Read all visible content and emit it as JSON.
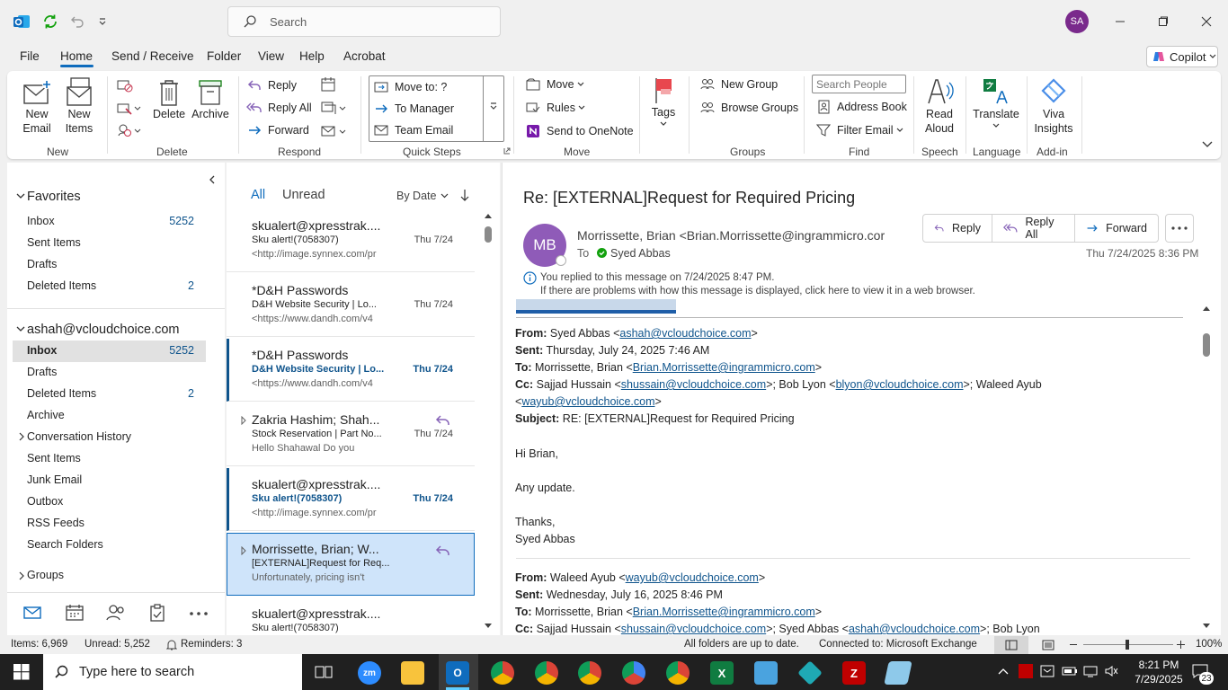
{
  "titlebar": {
    "search_placeholder": "Search",
    "avatar_initials": "SA"
  },
  "menu": {
    "tabs": [
      "File",
      "Home",
      "Send / Receive",
      "Folder",
      "View",
      "Help",
      "Acrobat"
    ],
    "copilot": "Copilot"
  },
  "ribbon": {
    "new_email": "New Email",
    "new_items": "New Items",
    "delete": "Delete",
    "archive": "Archive",
    "reply": "Reply",
    "reply_all": "Reply All",
    "forward": "Forward",
    "qs_move_to": "Move to: ?",
    "qs_to_manager": "To Manager",
    "qs_team_email": "Team Email",
    "move": "Move",
    "rules": "Rules",
    "send_onenote": "Send to OneNote",
    "tags": "Tags",
    "new_group": "New Group",
    "browse_groups": "Browse Groups",
    "search_people_placeholder": "Search People",
    "address_book": "Address Book",
    "filter_email": "Filter Email",
    "read_aloud": "Read Aloud",
    "translate": "Translate",
    "viva_insights": "Viva Insights",
    "groups": {
      "new": "New",
      "delete": "Delete",
      "respond": "Respond",
      "quick_steps": "Quick Steps",
      "move": "Move",
      "groups": "Groups",
      "find": "Find",
      "speech": "Speech",
      "language": "Language",
      "addin": "Add-in"
    }
  },
  "nav": {
    "favorites_label": "Favorites",
    "favorites": [
      {
        "label": "Inbox",
        "count": "5252"
      },
      {
        "label": "Sent Items",
        "count": ""
      },
      {
        "label": "Drafts",
        "count": ""
      },
      {
        "label": "Deleted Items",
        "count": "2"
      }
    ],
    "account": "ashah@vcloudchoice.com",
    "folders": [
      {
        "label": "Inbox",
        "count": "5252"
      },
      {
        "label": "Drafts",
        "count": ""
      },
      {
        "label": "Deleted Items",
        "count": "2"
      },
      {
        "label": "Archive",
        "count": ""
      },
      {
        "label": "Conversation History",
        "count": ""
      },
      {
        "label": "Sent Items",
        "count": ""
      },
      {
        "label": "Junk Email",
        "count": ""
      },
      {
        "label": "Outbox",
        "count": ""
      },
      {
        "label": "RSS Feeds",
        "count": ""
      },
      {
        "label": "Search Folders",
        "count": ""
      }
    ],
    "groups_label": "Groups"
  },
  "list": {
    "tab_all": "All",
    "tab_unread": "Unread",
    "sort": "By Date",
    "messages": [
      {
        "from": "skualert@xpresstrak....",
        "subject": "Sku alert!(7058307)",
        "date": "Thu 7/24",
        "preview": "<http://image.synnex.com/pr"
      },
      {
        "from": "*D&H Passwords",
        "subject": "D&H Website Security | Lo...",
        "date": "Thu 7/24",
        "preview": "<https://www.dandh.com/v4"
      },
      {
        "from": "*D&H Passwords",
        "subject": "D&H Website Security | Lo...",
        "date": "Thu 7/24",
        "preview": "<https://www.dandh.com/v4"
      },
      {
        "from": "Zakria Hashim;  Shah...",
        "subject": "Stock Reservation | Part No...",
        "date": "Thu 7/24",
        "preview": "Hello Shahawal  Do you"
      },
      {
        "from": "skualert@xpresstrak....",
        "subject": "Sku alert!(7058307)",
        "date": "Thu 7/24",
        "preview": "<http://image.synnex.com/pr"
      },
      {
        "from": "Morrissette, Brian;  W...",
        "subject": "[EXTERNAL]Request for Req...",
        "date": "",
        "preview": "Unfortunately, pricing isn't"
      },
      {
        "from": "skualert@xpresstrak....",
        "subject": "Sku alert!(7058307)",
        "date": "",
        "preview": ""
      }
    ]
  },
  "reading": {
    "subject": "Re: [EXTERNAL]Request for Required Pricing",
    "sender_initials": "MB",
    "sender": "Morrissette, Brian <Brian.Morrissette@ingrammicro.cor",
    "to_label": "To",
    "to_name": "Syed Abbas",
    "date": "Thu 7/24/2025 8:36 PM",
    "btn_reply": "Reply",
    "btn_reply_all": "Reply All",
    "btn_forward": "Forward",
    "info1": "You replied to this message on 7/24/2025 8:47 PM.",
    "info2": "If there are problems with how this message is displayed, click here to view it in a web browser.",
    "b1_from_label": "From:",
    "b1_from_name": " Syed Abbas <",
    "b1_from_email": "ashah@vcloudchoice.com",
    "b1_sent_label": "Sent:",
    "b1_sent": " Thursday, July 24, 2025 7:46 AM",
    "b1_to_label": "To:",
    "b1_to_name": " Morrissette, Brian <",
    "b1_to_email": "Brian.Morrissette@ingrammicro.com",
    "b1_cc_label": "Cc:",
    "b1_cc_1": " Sajjad Hussain <",
    "b1_cc_1_email": "shussain@vcloudchoice.com",
    "b1_cc_2": ">; Bob Lyon <",
    "b1_cc_2_email": "blyon@vcloudchoice.com",
    "b1_cc_3": ">; Waleed Ayub",
    "b1_cc_4_email": "wayub@vcloudchoice.com",
    "b1_subject_label": "Subject:",
    "b1_subject": " RE: [EXTERNAL]Request for Required Pricing",
    "greeting": "Hi Brian,",
    "line1": "Any update.",
    "thanks": "Thanks,",
    "sig": "Syed Abbas",
    "b2_from_label": "From:",
    "b2_from_name": " Waleed Ayub <",
    "b2_from_email": "wayub@vcloudchoice.com",
    "b2_sent_label": "Sent:",
    "b2_sent": " Wednesday, July 16, 2025 8:46 PM",
    "b2_to_label": "To:",
    "b2_to_name": " Morrissette, Brian <",
    "b2_to_email": "Brian.Morrissette@ingrammicro.com",
    "b2_cc_label": "Cc:",
    "b2_cc_1": " Sajjad Hussain <",
    "b2_cc_1_email": "shussain@vcloudchoice.com",
    "b2_cc_2": ">; Syed Abbas <",
    "b2_cc_2_email": "ashah@vcloudchoice.com",
    "b2_cc_3": ">; Bob Lyon"
  },
  "status": {
    "items": "Items: 6,969",
    "unread": "Unread: 5,252",
    "reminders": "Reminders: 3",
    "sync": "All folders are up to date.",
    "connection": "Connected to: Microsoft Exchange",
    "zoom": "100%"
  },
  "taskbar": {
    "search_placeholder": "Type here to search",
    "time": "8:21 PM",
    "date": "7/29/2025",
    "notif_count": "23"
  },
  "colors": {
    "accent": "#0f6cbd",
    "unread": "#0f548c",
    "avatar": "#7a2a8c",
    "sender_avatar": "#8f5bb8"
  }
}
